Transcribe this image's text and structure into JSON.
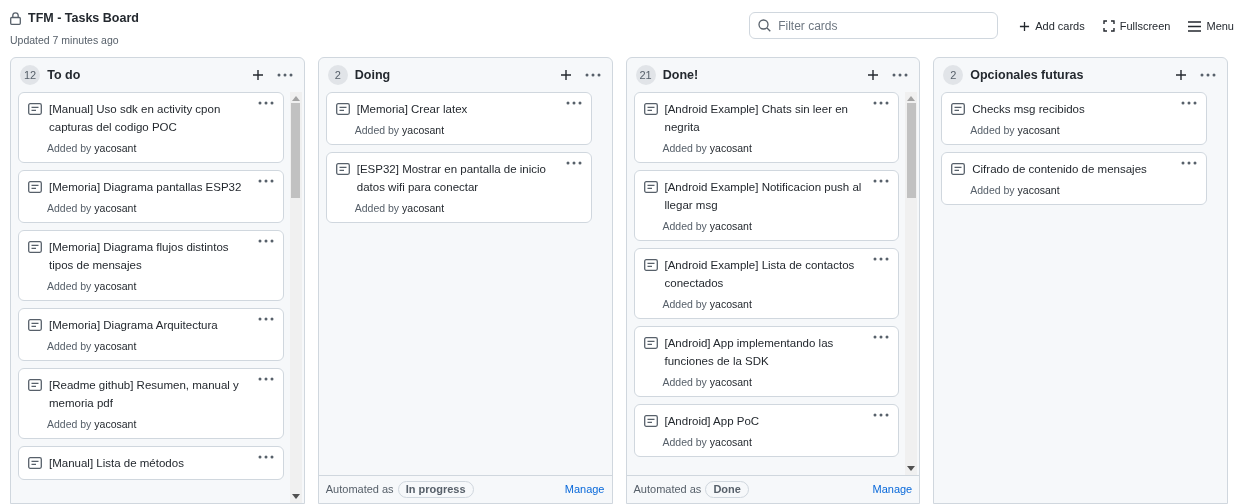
{
  "board": {
    "title": "TFM - Tasks Board",
    "updated": "Updated 7 minutes ago"
  },
  "toolbar": {
    "filter": {
      "placeholder": "Filter cards"
    },
    "actions": [
      {
        "kind": "add",
        "label": "Add cards"
      },
      {
        "kind": "fullscreen",
        "label": "Fullscreen"
      },
      {
        "kind": "menu",
        "label": "Menu"
      }
    ]
  },
  "columns": [
    {
      "count": "12",
      "name": "To do",
      "scrollbar": true,
      "cards": [
        {
          "title": "[Manual] Uso sdk en activity cpon capturas del codigo POC",
          "added_by": "Added by",
          "author": "yacosant"
        },
        {
          "title": "[Memoria] Diagrama pantallas ESP32",
          "added_by": "Added by",
          "author": "yacosant"
        },
        {
          "title": "[Memoria] Diagrama flujos distintos tipos de mensajes",
          "added_by": "Added by",
          "author": "yacosant"
        },
        {
          "title": "[Memoria] Diagrama Arquitectura",
          "added_by": "Added by",
          "author": "yacosant"
        },
        {
          "title": "[Readme github] Resumen, manual y memoria pdf",
          "added_by": "Added by",
          "author": "yacosant"
        },
        {
          "title": "[Manual] Lista de métodos"
        }
      ]
    },
    {
      "count": "2",
      "name": "Doing",
      "scrollbar": false,
      "cards": [
        {
          "title": "[Memoria] Crear latex",
          "added_by": "Added by",
          "author": "yacosant"
        },
        {
          "title": "[ESP32] Mostrar en pantalla de inicio datos wifi para conectar",
          "added_by": "Added by",
          "author": "yacosant"
        }
      ],
      "footer": {
        "label": "Automated as",
        "status": "In progress",
        "link": "Manage"
      }
    },
    {
      "count": "21",
      "name": "Done!",
      "scrollbar": true,
      "cards": [
        {
          "title": "[Android Example] Chats sin leer en negrita",
          "added_by": "Added by",
          "author": "yacosant"
        },
        {
          "title": "[Android Example] Notificacion push al llegar msg",
          "added_by": "Added by",
          "author": "yacosant"
        },
        {
          "title": "[Android Example] Lista de contactos conectados",
          "added_by": "Added by",
          "author": "yacosant"
        },
        {
          "title": "[Android] App implementando las funciones de la SDK",
          "added_by": "Added by",
          "author": "yacosant"
        },
        {
          "title": "[Android] App PoC",
          "added_by": "Added by",
          "author": "yacosant"
        }
      ],
      "footer": {
        "label": "Automated as",
        "status": "Done",
        "link": "Manage"
      }
    },
    {
      "count": "2",
      "name": "Opcionales futuras",
      "scrollbar": false,
      "cards": [
        {
          "title": "Checks msg recibidos",
          "added_by": "Added by",
          "author": "yacosant"
        },
        {
          "title": "Cifrado de contenido de mensajes",
          "added_by": "Added by",
          "author": "yacosant"
        }
      ]
    }
  ]
}
